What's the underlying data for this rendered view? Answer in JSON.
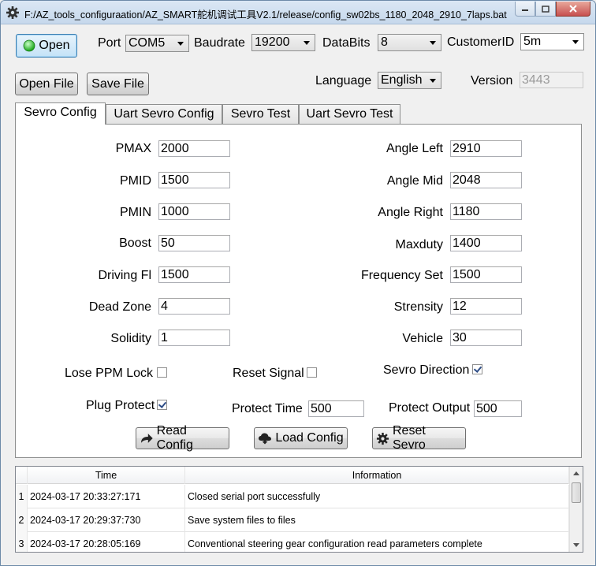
{
  "window": {
    "title": "F:/AZ_tools_configuraation/AZ_SMART舵机调试工具V2.1/release/config_sw02bs_1180_2048_2910_7laps.bat(AZSM...",
    "icon": "gear-icon"
  },
  "toolbar": {
    "open_label": "Open",
    "open_status_color": "#3ec63e",
    "port_label": "Port",
    "port_value": "COM5",
    "baudrate_label": "Baudrate",
    "baudrate_value": "19200",
    "databits_label": "DataBits",
    "databits_value": "8",
    "customerid_label": "CustomerID",
    "customerid_value": "5m",
    "open_file_label": "Open File",
    "save_file_label": "Save File",
    "language_label": "Language",
    "language_value": "English",
    "version_label": "Version",
    "version_value": "3443"
  },
  "tabs": [
    {
      "label": "Sevro Config",
      "active": true
    },
    {
      "label": "Uart Sevro Config",
      "active": false
    },
    {
      "label": "Sevro Test",
      "active": false
    },
    {
      "label": "Uart Sevro Test",
      "active": false
    }
  ],
  "config": {
    "left": [
      {
        "label": "PMAX",
        "value": "2000"
      },
      {
        "label": "PMID",
        "value": "1500"
      },
      {
        "label": "PMIN",
        "value": "1000"
      },
      {
        "label": "Boost",
        "value": "50"
      },
      {
        "label": "Driving Fl",
        "value": "1500"
      },
      {
        "label": "Dead Zone",
        "value": "4"
      },
      {
        "label": "Solidity",
        "value": "1"
      }
    ],
    "right": [
      {
        "label": "Angle Left",
        "value": "2910"
      },
      {
        "label": "Angle Mid",
        "value": "2048"
      },
      {
        "label": "Angle Right",
        "value": "1180"
      },
      {
        "label": "Maxduty",
        "value": "1400"
      },
      {
        "label": "Frequency Set",
        "value": "1500"
      },
      {
        "label": "Strensity",
        "value": "12"
      },
      {
        "label": "Vehicle",
        "value": "30"
      }
    ],
    "lose_ppm_lock_label": "Lose PPM Lock",
    "lose_ppm_lock_checked": false,
    "reset_signal_label": "Reset Signal",
    "reset_signal_checked": false,
    "sevro_direction_label": "Sevro Direction",
    "sevro_direction_checked": true,
    "plug_protect_label": "Plug Protect",
    "plug_protect_checked": true,
    "protect_time_label": "Protect Time",
    "protect_time_value": "500",
    "protect_output_label": "Protect Output",
    "protect_output_value": "500",
    "read_config_label": "Read Config",
    "load_config_label": "Load Config",
    "reset_sevro_label": "Reset Sevro"
  },
  "log": {
    "columns": [
      "Time",
      "Information"
    ],
    "rows": [
      {
        "index": "1",
        "time": "2024-03-17 20:33:27:171",
        "info": "Closed serial port successfully"
      },
      {
        "index": "2",
        "time": "2024-03-17 20:29:37:730",
        "info": "Save system files to files"
      },
      {
        "index": "3",
        "time": "2024-03-17 20:28:05:169",
        "info": "Conventional steering gear configuration read parameters complete"
      }
    ]
  }
}
